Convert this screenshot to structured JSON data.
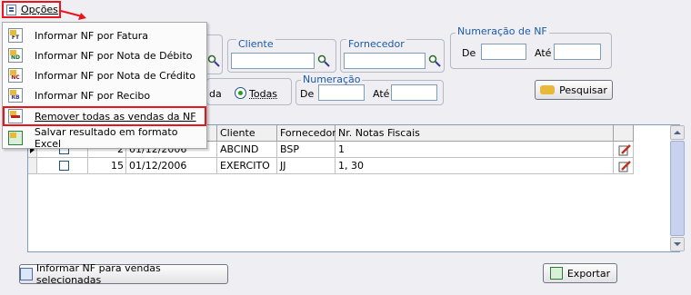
{
  "menu": {
    "options_label": "Opções"
  },
  "dropdown": {
    "items": [
      {
        "label": "Informar NF por Fatura",
        "icon": "ft-icon",
        "badge": "FT"
      },
      {
        "label": "Informar NF por Nota de Débito",
        "icon": "nd-icon",
        "badge": "ND"
      },
      {
        "label": "Informar NF por Nota de Crédito",
        "icon": "nc-icon",
        "badge": "NC"
      },
      {
        "label": "Informar NF por Recibo",
        "icon": "rb-icon",
        "badge": "RB"
      },
      {
        "label": "Remover todas as vendas da NF",
        "icon": "remove-list-icon",
        "badge": ""
      },
      {
        "label": "Salvar resultado em formato Excel",
        "icon": "excel-icon",
        "badge": ""
      }
    ]
  },
  "filters": {
    "cliente_legend": "Cliente",
    "cliente_value": "",
    "fornecedor_legend": "Fornecedor",
    "fornecedor_value": "",
    "numeracao_nf_legend": "Numeração de NF",
    "nf_de_label": "De",
    "nf_ate_label": "Até",
    "nf_de_value": "",
    "nf_ate_value": "",
    "numeracao_legend": "Numeração",
    "num_de_label": "De",
    "num_ate_label": "Até",
    "num_de_value": "",
    "num_ate_value": "",
    "radio_partial_label": "da",
    "radio_todas_label": "Todas",
    "radio_selected": "Todas"
  },
  "search_button": "Pesquisar",
  "table": {
    "headers": [
      "Cliente",
      "Fornecedor",
      "Nr. Notas Fiscais"
    ],
    "rows": [
      {
        "num": "2",
        "date": "01/12/2006",
        "cliente": "ABCIND",
        "fornecedor": "BSP",
        "notas": "1"
      },
      {
        "num": "15",
        "date": "01/12/2006",
        "cliente": "EXERCITO",
        "fornecedor": "JJ",
        "notas": "1, 30"
      }
    ]
  },
  "bottom": {
    "informar_button": "Informar NF para vendas selecionadas",
    "exportar_button": "Exportar"
  },
  "colors": {
    "highlight": "#e8161c",
    "legend_text": "#1d5aa8"
  }
}
